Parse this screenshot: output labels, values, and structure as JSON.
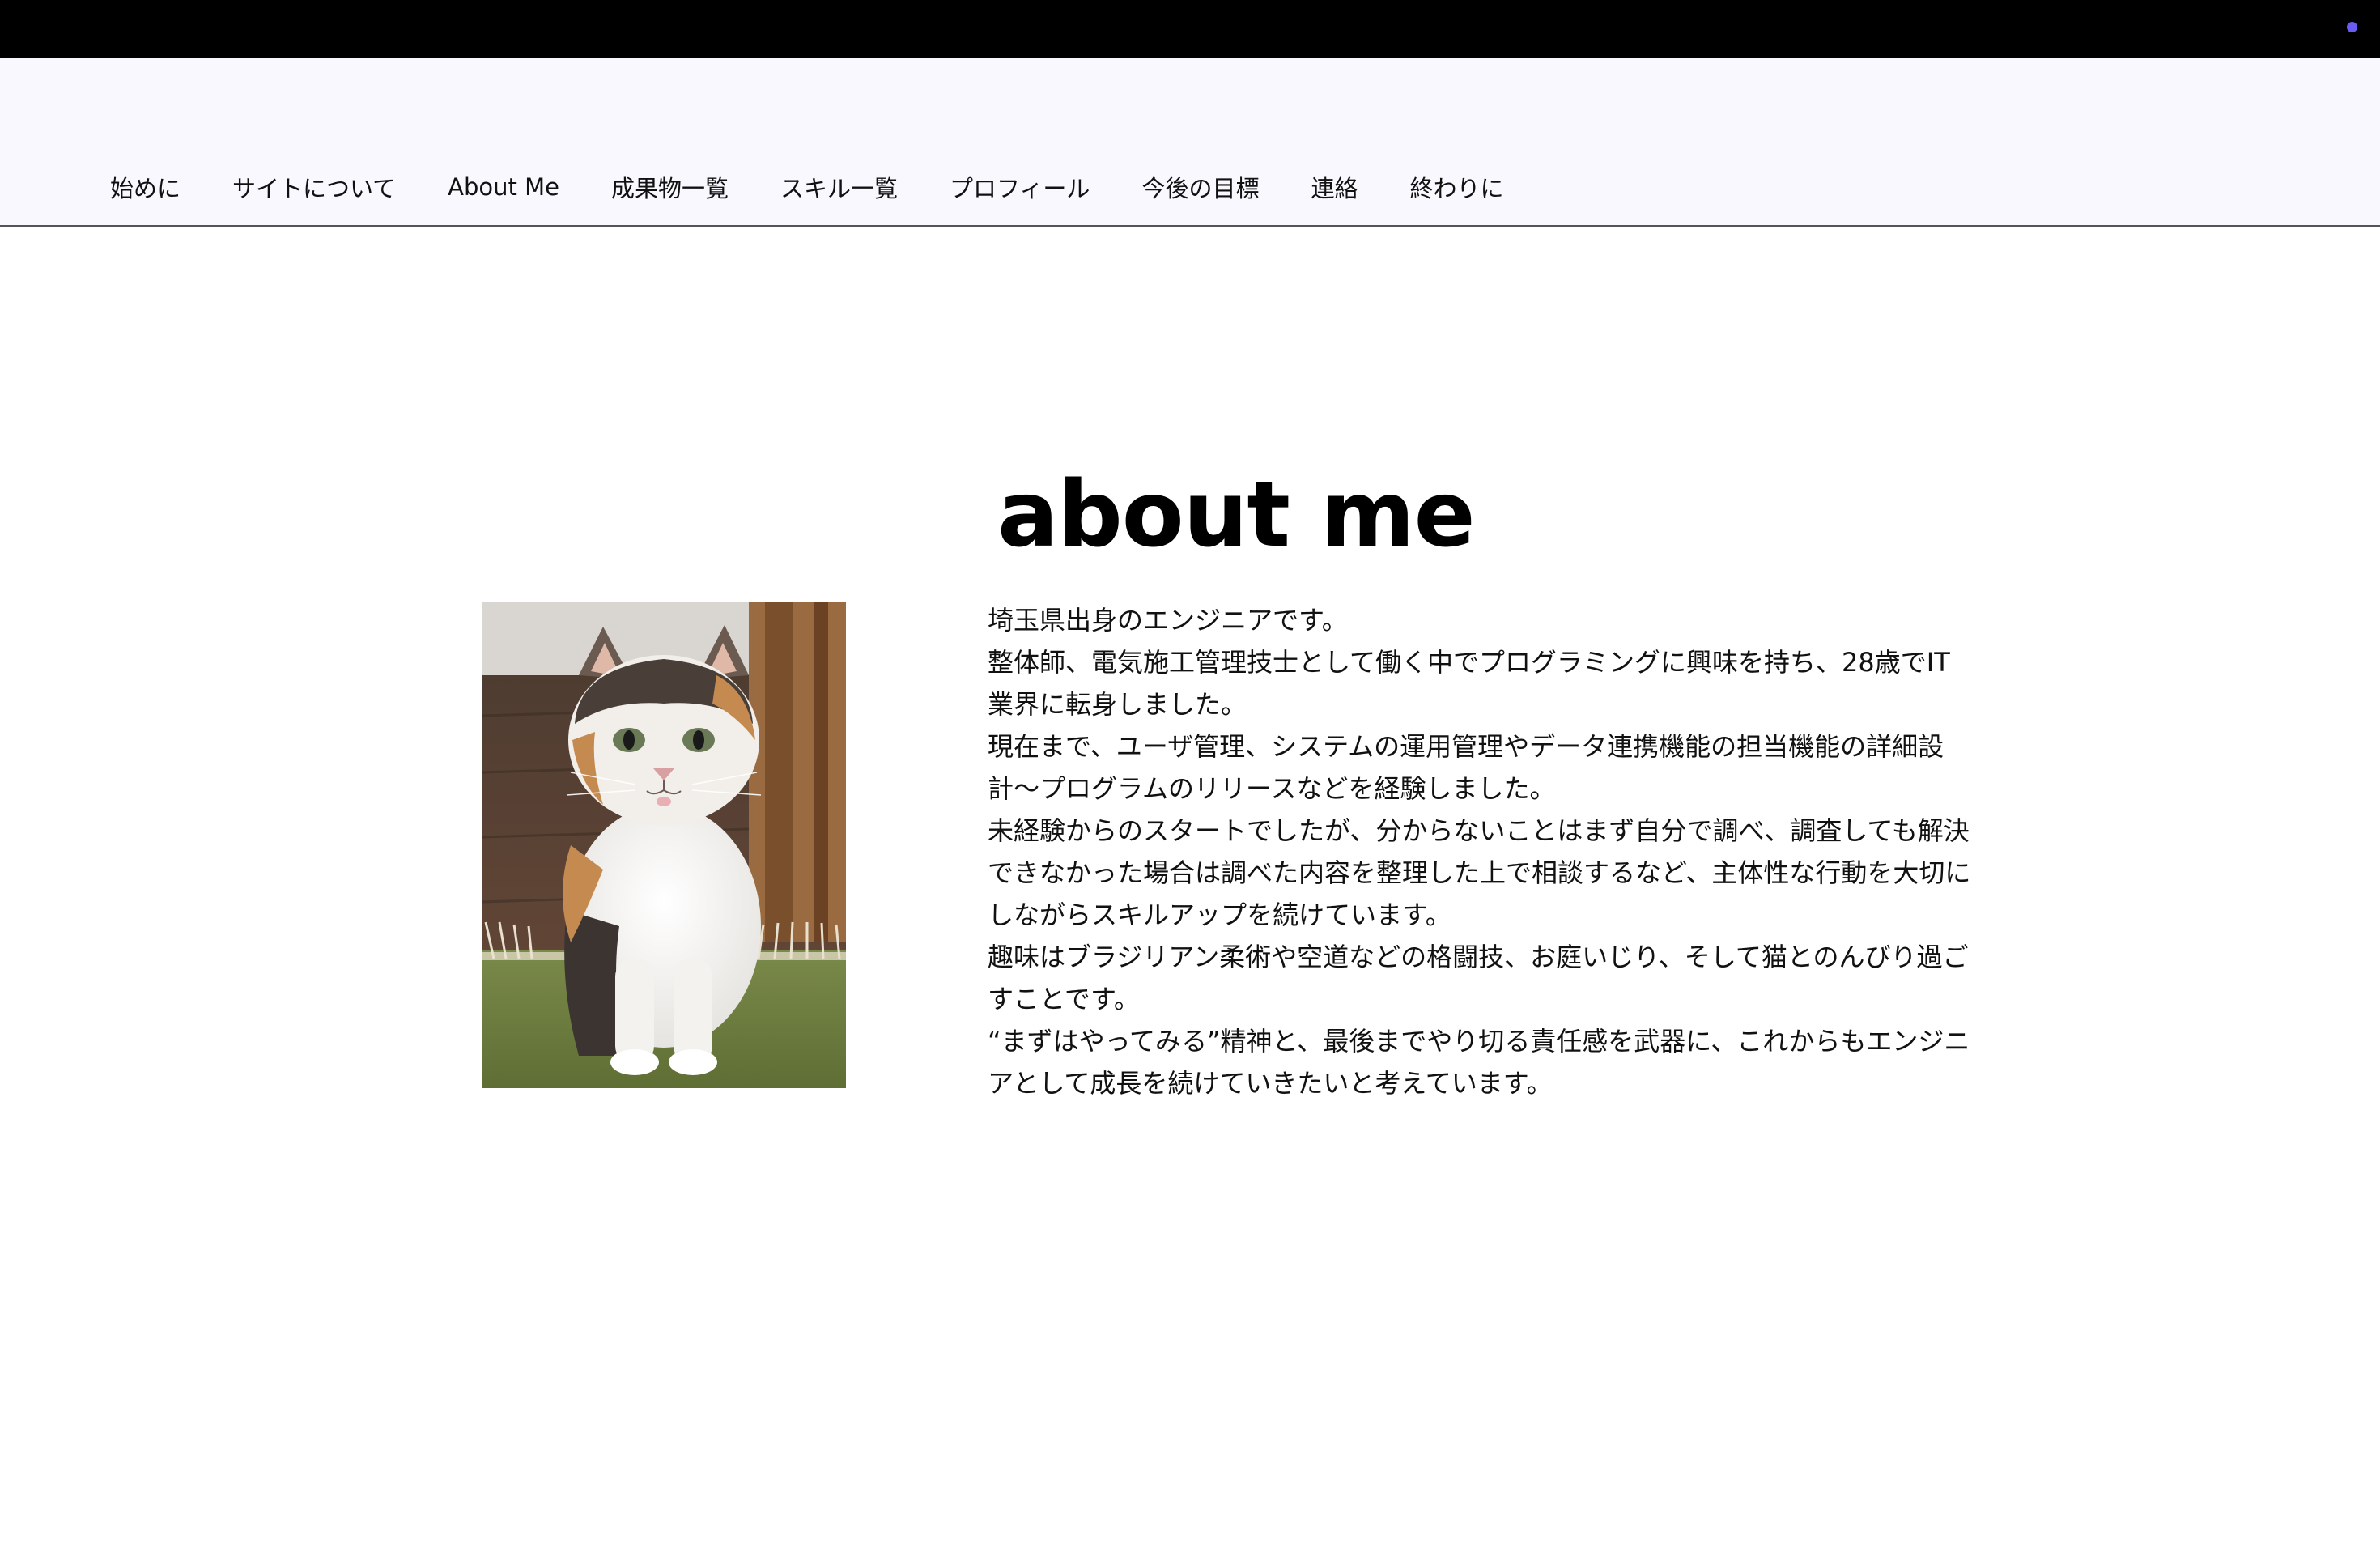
{
  "status_indicator": {
    "color": "#6a5cf0"
  },
  "nav": {
    "items": [
      {
        "label": "始めに",
        "name": "nav-item-hajimeni"
      },
      {
        "label": "サイトについて",
        "name": "nav-item-site"
      },
      {
        "label": "About Me",
        "name": "nav-item-about-me"
      },
      {
        "label": "成果物一覧",
        "name": "nav-item-works"
      },
      {
        "label": "スキル一覧",
        "name": "nav-item-skills"
      },
      {
        "label": "プロフィール",
        "name": "nav-item-profile"
      },
      {
        "label": "今後の目標",
        "name": "nav-item-goals"
      },
      {
        "label": "連絡",
        "name": "nav-item-contact"
      },
      {
        "label": "終わりに",
        "name": "nav-item-owarini"
      }
    ]
  },
  "about": {
    "title": "about me",
    "photo": {
      "subject": "calico cat sitting on a green mat"
    },
    "paragraphs": [
      "埼玉県出身のエンジニアです。",
      "整体師、電気施工管理技士として働く中でプログラミングに興味を持ち、28歳でIT業界に転身しました。",
      "現在まで、ユーザ管理、システムの運用管理やデータ連携機能の担当機能の詳細設計〜プログラムのリリースなどを経験しました。",
      "未経験からのスタートでしたが、分からないことはまず自分で調べ、調査しても解決できなかった場合は調べた内容を整理した上で相談するなど、主体性な行動を大切にしながらスキルアップを続けています。",
      "趣味はブラジリアン柔術や空道などの格闘技、お庭いじり、そして猫とのんびり過ごすことです。",
      "“まずはやってみる”精神と、最後までやり切る責任感を武器に、これからもエンジニアとして成長を続けていきたいと考えています。"
    ]
  }
}
